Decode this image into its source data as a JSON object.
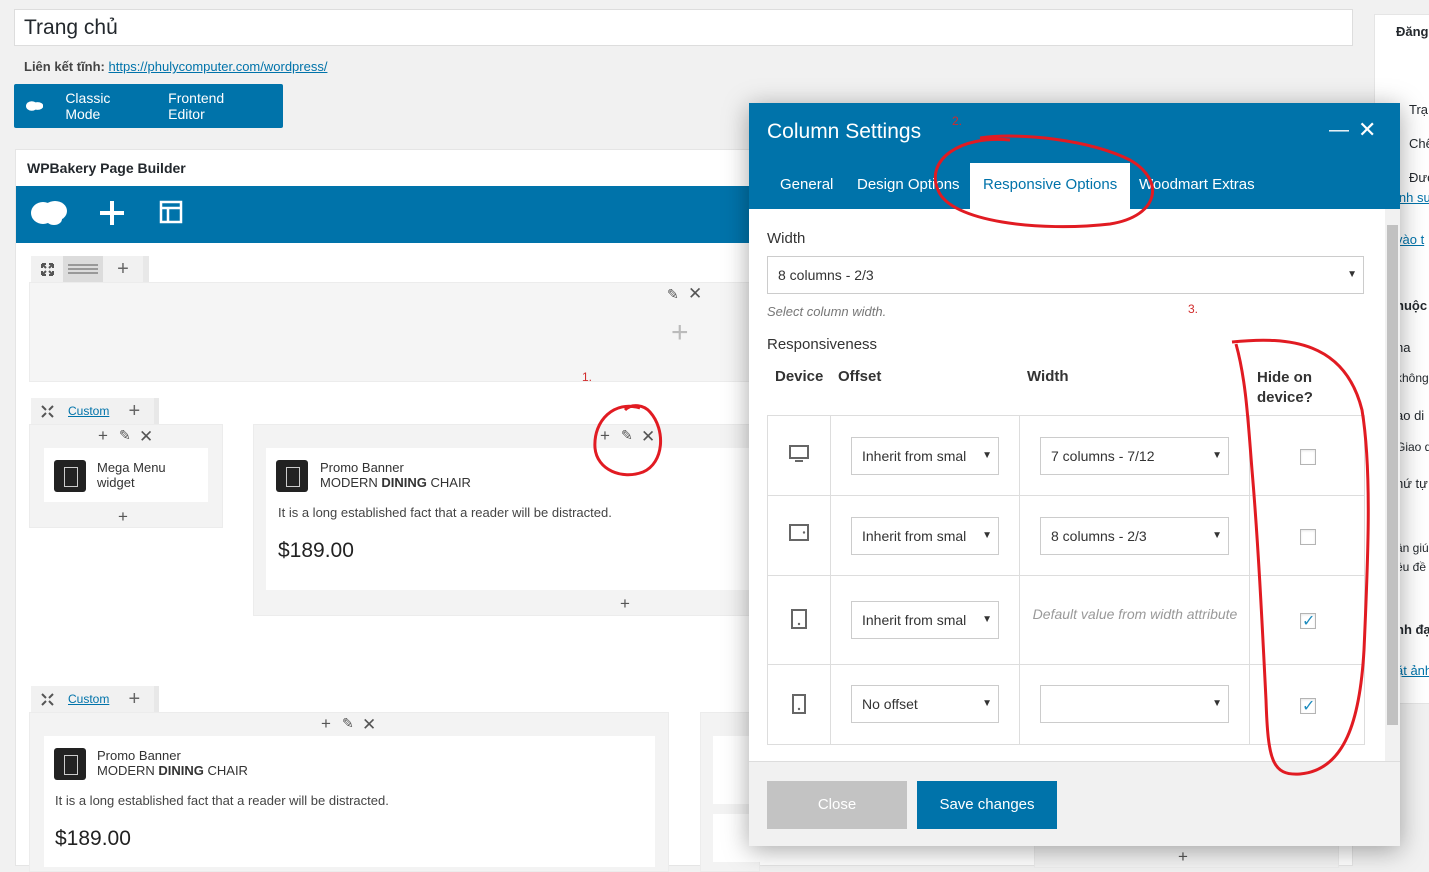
{
  "page": {
    "title_value": "Trang chủ",
    "permalink_label": "Liên kết tĩnh:",
    "permalink_url": "https://phulycomputer.com/wordpress/"
  },
  "modes": {
    "classic": "Classic Mode",
    "frontend": "Frontend Editor"
  },
  "builder": {
    "title": "WPBakery Page Builder",
    "custom_label": "Custom",
    "widgets": {
      "mega_menu_title": "Mega Menu",
      "mega_menu_sub": "widget",
      "promo_title": "Promo Banner",
      "promo_sub_prefix": "MODERN ",
      "promo_sub_bold": "DINING",
      "promo_sub_suffix": " CHAIR",
      "promo_text": "It is a long established fact that a reader will be distracted.",
      "promo_price": "$189.00"
    }
  },
  "sidebar_partial": {
    "publish_title": "Đăng b",
    "line1": "Trạ",
    "line2": "Chế",
    "line3": "Đượ",
    "link1": "ỉnh sư",
    "link2": "vào t",
    "attr_title": "huộc",
    "attr1": "ha",
    "attr2": "không",
    "attr3": "ao di",
    "attr4": "Giao d",
    "attr5": "hứ tự",
    "help1": "ần giú",
    "help2": "ều đề",
    "thumb_title": "nh đạ",
    "thumb_link": "ặt ảnh"
  },
  "modal": {
    "title": "Column Settings",
    "tabs": [
      "General",
      "Design Options",
      "Responsive Options",
      "Woodmart Extras"
    ],
    "active_tab": "Responsive Options",
    "width_label": "Width",
    "width_value": "8 columns - 2/3",
    "width_hint": "Select column width.",
    "responsiveness_label": "Responsiveness",
    "headers": {
      "device": "Device",
      "offset": "Offset",
      "width": "Width",
      "hide": "Hide on device?"
    },
    "rows": [
      {
        "device": "desktop-icon",
        "offset": "Inherit from smal",
        "width": "7 columns - 7/12",
        "hide": false
      },
      {
        "device": "tablet-landscape-icon",
        "offset": "Inherit from smal",
        "width": "8 columns - 2/3",
        "hide": false
      },
      {
        "device": "tablet-portrait-icon",
        "offset": "Inherit from smal",
        "width_default": "Default value from width attribute",
        "hide": true
      },
      {
        "device": "mobile-icon",
        "offset": "No offset",
        "width": "",
        "hide": true
      }
    ],
    "close_label": "Close",
    "save_label": "Save changes"
  },
  "annotations": {
    "n1": "1.",
    "n2": "2.",
    "n3": "3."
  },
  "colors": {
    "accent": "#0073aa",
    "annotation": "#e11b22"
  }
}
